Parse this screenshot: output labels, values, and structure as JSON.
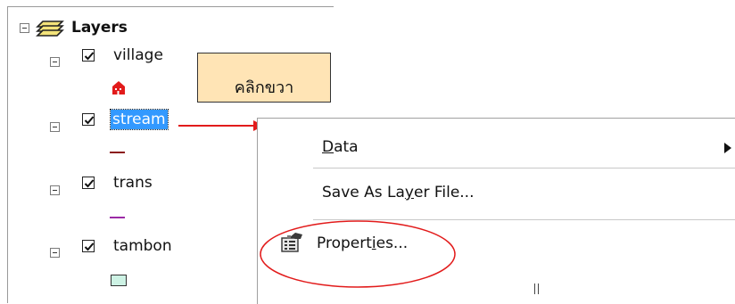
{
  "toc": {
    "root": {
      "label": "Layers"
    },
    "layers": [
      {
        "name": "village",
        "checked": true,
        "symbol": "house-marker",
        "symbol_color": "#e21b1b"
      },
      {
        "name": "stream",
        "checked": true,
        "selected": true,
        "symbol": "line",
        "symbol_color": "#8b1a1a"
      },
      {
        "name": "trans",
        "checked": true,
        "symbol": "line",
        "symbol_color": "#9b2aa6"
      },
      {
        "name": "tambon",
        "checked": true,
        "symbol": "polygon",
        "symbol_color": "#cdf2e4"
      }
    ]
  },
  "callout": {
    "text": "คลิกขวา",
    "background": "#ffe4b5"
  },
  "context_menu": {
    "items": [
      {
        "label": "Data",
        "mnemonic": "D",
        "has_submenu": true
      },
      {
        "label": "Save As Layer File...",
        "mnemonic": "y"
      },
      {
        "label": "Properties...",
        "mnemonic": "i",
        "icon": "properties-icon"
      }
    ]
  },
  "colors": {
    "selection": "#3399ff",
    "arrow": "#e21b1b",
    "highlight_circle": "#e21b1b"
  }
}
